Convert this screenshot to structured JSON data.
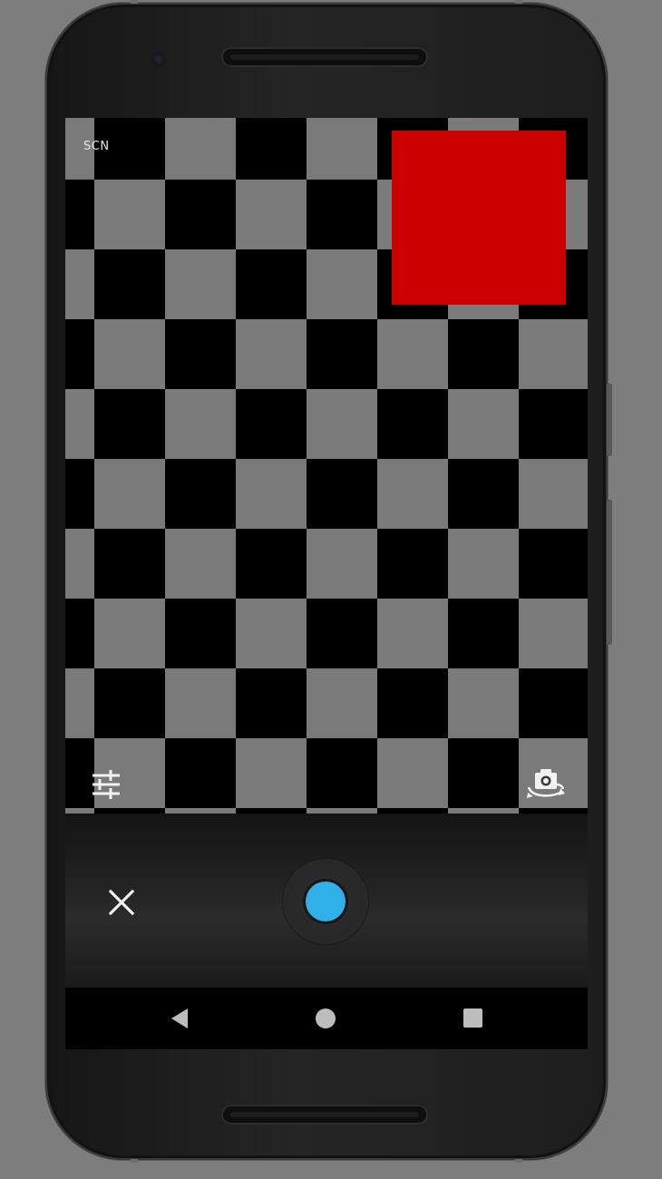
{
  "camera": {
    "scene_mode_label": "SCN",
    "shutter_accent": "#2fb0e8",
    "target_color": "#cc0000"
  },
  "icons": {
    "settings": "sliders-icon",
    "switch_camera": "camera-flip-icon",
    "close": "close-icon",
    "shutter": "shutter-button",
    "back": "back-triangle-icon",
    "home": "home-circle-icon",
    "recents": "recents-square-icon"
  }
}
